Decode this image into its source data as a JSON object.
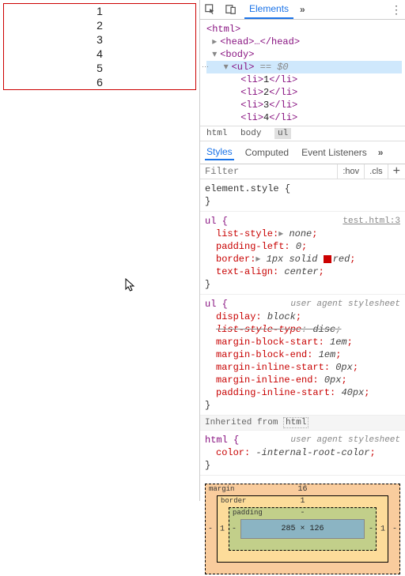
{
  "page": {
    "items": [
      "1",
      "2",
      "3",
      "4",
      "5",
      "6"
    ]
  },
  "toolbar": {
    "tab_elements": "Elements",
    "more": "»",
    "menu": "⋮"
  },
  "dom": {
    "html_open": "<html>",
    "head": "<head>…</head>",
    "body_open": "<body>",
    "ul_open": "<ul>",
    "eq": " == $0",
    "li": [
      {
        "open": "<li>",
        "txt": "1",
        "close": "</li>"
      },
      {
        "open": "<li>",
        "txt": "2",
        "close": "</li>"
      },
      {
        "open": "<li>",
        "txt": "3",
        "close": "</li>"
      },
      {
        "open": "<li>",
        "txt": "4",
        "close": "</li>"
      }
    ]
  },
  "crumbs": {
    "a": "html",
    "b": "body",
    "c": "ul"
  },
  "subtabs": {
    "styles": "Styles",
    "computed": "Computed",
    "listeners": "Event Listeners",
    "more": "»"
  },
  "filter": {
    "placeholder": "Filter",
    "hov": ":hov",
    "cls": ".cls",
    "plus": "+"
  },
  "rules": {
    "element_style": "element.style {",
    "close": "}",
    "ul_sel": "ul {",
    "ul_src": "test.html:3",
    "ul_props": [
      {
        "n": "list-style",
        "v": "none",
        "tri": true
      },
      {
        "n": "padding-left",
        "v": "0"
      },
      {
        "n": "border",
        "v": "1px solid ",
        "swatch": true,
        "v2": "red",
        "tri": true
      },
      {
        "n": "text-align",
        "v": "center"
      }
    ],
    "ua_label": "user agent stylesheet",
    "ua_sel": "ul {",
    "ua_props": [
      {
        "n": "display",
        "v": "block"
      },
      {
        "n": "list-style-type",
        "v": "disc",
        "strike": true
      },
      {
        "n": "margin-block-start",
        "v": "1em"
      },
      {
        "n": "margin-block-end",
        "v": "1em"
      },
      {
        "n": "margin-inline-start",
        "v": "0px"
      },
      {
        "n": "margin-inline-end",
        "v": "0px"
      },
      {
        "n": "padding-inline-start",
        "v": "40px"
      }
    ],
    "inherit_label": "Inherited from ",
    "inherit_from": "html",
    "html_sel": "html {",
    "html_props": [
      {
        "n": "color",
        "v": "-internal-root-color"
      }
    ]
  },
  "boxmodel": {
    "margin_label": "margin",
    "margin_top": "16",
    "border_label": "border",
    "border_top": "1",
    "border_side": "1",
    "padding_label": "padding",
    "padding_top": "-",
    "padding_side": "-",
    "content": "285 × 126",
    "margin_side": "-"
  }
}
